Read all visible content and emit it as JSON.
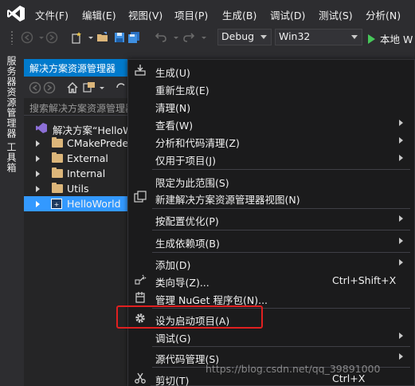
{
  "menubar": {
    "items": [
      "文件(F)",
      "编辑(E)",
      "视图(V)",
      "项目(P)",
      "生成(B)",
      "调试(D)",
      "测试(S)",
      "分析(N)"
    ]
  },
  "toolbar": {
    "config": "Debug",
    "platform": "Win32",
    "run_label": "本地 W"
  },
  "side_tabs": {
    "server_explorer": "服务器资源管理器",
    "toolbox": "工具箱"
  },
  "solution_explorer": {
    "title": "解决方案资源管理器",
    "search_placeholder": "搜索解决方案资源管理器",
    "tree": [
      {
        "label": "解决方案“HelloW",
        "kind": "solution",
        "expander": false,
        "selected": false
      },
      {
        "label": "CMakePrede",
        "kind": "folder",
        "expander": true,
        "selected": false
      },
      {
        "label": "External",
        "kind": "folder",
        "expander": true,
        "selected": false
      },
      {
        "label": "Internal",
        "kind": "folder",
        "expander": true,
        "selected": false
      },
      {
        "label": "Utils",
        "kind": "folder",
        "expander": true,
        "selected": false
      },
      {
        "label": "HelloWorld",
        "kind": "project",
        "expander": true,
        "selected": true
      }
    ]
  },
  "context_menu": {
    "items": [
      {
        "label": "生成(U)",
        "icon": "build-icon",
        "submenu": false,
        "shortcut": ""
      },
      {
        "label": "重新生成(E)",
        "icon": "",
        "submenu": false,
        "shortcut": ""
      },
      {
        "label": "清理(N)",
        "icon": "",
        "submenu": false,
        "shortcut": ""
      },
      {
        "label": "查看(W)",
        "icon": "",
        "submenu": true,
        "shortcut": ""
      },
      {
        "label": "分析和代码清理(Z)",
        "icon": "",
        "submenu": true,
        "shortcut": ""
      },
      {
        "label": "仅用于项目(J)",
        "icon": "",
        "submenu": true,
        "shortcut": ""
      },
      {
        "label": "限定为此范围(S)",
        "icon": "",
        "submenu": false,
        "shortcut": ""
      },
      {
        "label": "新建解决方案资源管理器视图(N)",
        "icon": "new-view-icon",
        "submenu": false,
        "shortcut": ""
      },
      {
        "label": "按配置优化(P)",
        "icon": "",
        "submenu": true,
        "shortcut": ""
      },
      {
        "label": "生成依赖项(B)",
        "icon": "",
        "submenu": true,
        "shortcut": ""
      },
      {
        "label": "添加(D)",
        "icon": "",
        "submenu": true,
        "shortcut": ""
      },
      {
        "label": "类向导(Z)...",
        "icon": "class-wizard-icon",
        "submenu": false,
        "shortcut": "Ctrl+Shift+X"
      },
      {
        "label": "管理 NuGet 程序包(N)...",
        "icon": "nuget-icon",
        "submenu": false,
        "shortcut": ""
      },
      {
        "label": "设为启动项目(A)",
        "icon": "gear-icon",
        "submenu": false,
        "shortcut": ""
      },
      {
        "label": "调试(G)",
        "icon": "",
        "submenu": true,
        "shortcut": ""
      },
      {
        "label": "源代码管理(S)",
        "icon": "",
        "submenu": true,
        "shortcut": ""
      },
      {
        "label": "剪切(T)",
        "icon": "scissors-icon",
        "submenu": false,
        "shortcut": "Ctrl+X"
      }
    ]
  },
  "watermark": "https://blog.csdn.net/qq_39891000",
  "colors": {
    "accent": "#007acc",
    "selection": "#3399ff",
    "highlight_box": "#e02020",
    "background": "#2d2d30",
    "menu_bg": "#1b1b1c"
  }
}
